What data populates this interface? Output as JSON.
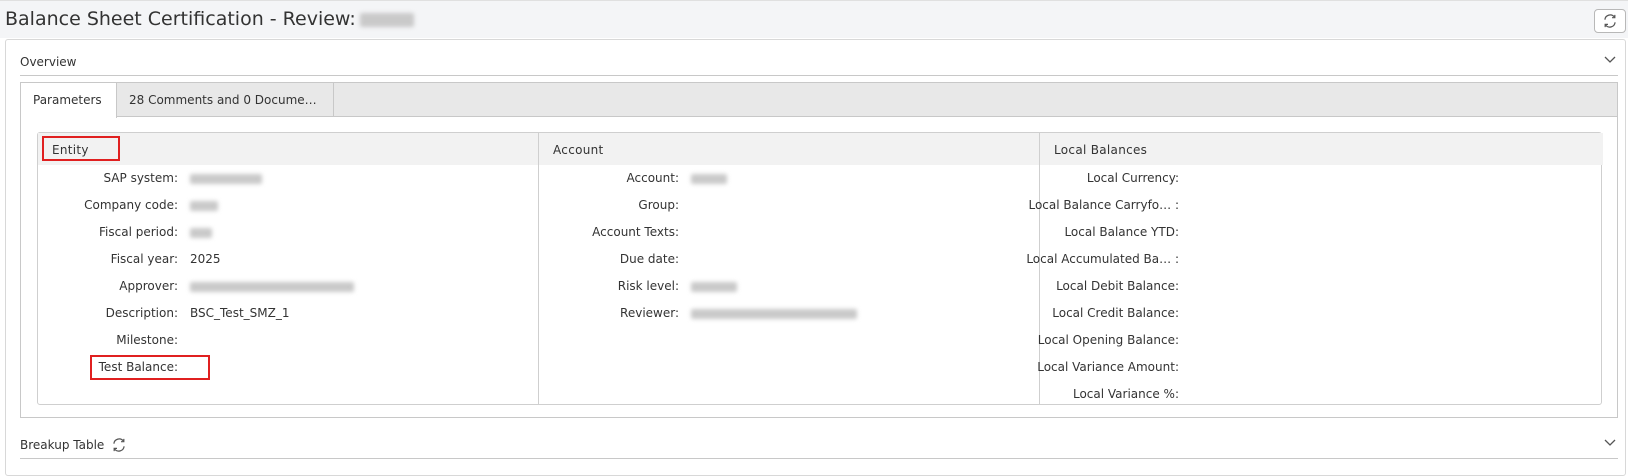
{
  "header": {
    "title": "Balance Sheet Certification - Review:",
    "refresh_icon": "refresh-icon"
  },
  "overview": {
    "label": "Overview",
    "tabs": [
      {
        "label": "Parameters",
        "active": true
      },
      {
        "label": "28 Comments and 0 Docume…",
        "active": false
      }
    ],
    "columns": {
      "entity": {
        "title": "Entity",
        "fields": [
          {
            "label": "SAP system:",
            "value": "",
            "redacted": true
          },
          {
            "label": "Company code:",
            "value": "",
            "redacted": true
          },
          {
            "label": "Fiscal period:",
            "value": "",
            "redacted": true
          },
          {
            "label": "Fiscal year:",
            "value": "2025"
          },
          {
            "label": "Approver:",
            "value": "",
            "redacted": true
          },
          {
            "label": "Description:",
            "value": "BSC_Test_SMZ_1"
          },
          {
            "label": "Milestone:",
            "value": ""
          },
          {
            "label": "Test Balance:",
            "value": ""
          }
        ]
      },
      "account": {
        "title": "Account",
        "fields": [
          {
            "label": "Account:",
            "value": "",
            "redacted": true
          },
          {
            "label": "Group:",
            "value": ""
          },
          {
            "label": "Account Texts:",
            "value": ""
          },
          {
            "label": "Due date:",
            "value": ""
          },
          {
            "label": "Risk level:",
            "value": "",
            "redacted": true
          },
          {
            "label": "Reviewer:",
            "value": "",
            "redacted": true
          }
        ]
      },
      "local_balances": {
        "title": "Local Balances",
        "fields": [
          {
            "label": "Local Currency:",
            "value": ""
          },
          {
            "label": "Local Balance Carryfo… :",
            "value": ""
          },
          {
            "label": "Local Balance YTD:",
            "value": ""
          },
          {
            "label": "Local Accumulated Ba… :",
            "value": ""
          },
          {
            "label": "Local Debit Balance:",
            "value": ""
          },
          {
            "label": "Local Credit Balance:",
            "value": ""
          },
          {
            "label": "Local Opening Balance:",
            "value": ""
          },
          {
            "label": "Local Variance Amount:",
            "value": ""
          },
          {
            "label": "Local Variance %:",
            "value": ""
          }
        ]
      }
    }
  },
  "breakup": {
    "label": "Breakup Table"
  },
  "colors": {
    "highlight_box": "#e02020",
    "header_bg": "#f4f5f7",
    "tabstrip_bg": "#e8e8e8"
  }
}
